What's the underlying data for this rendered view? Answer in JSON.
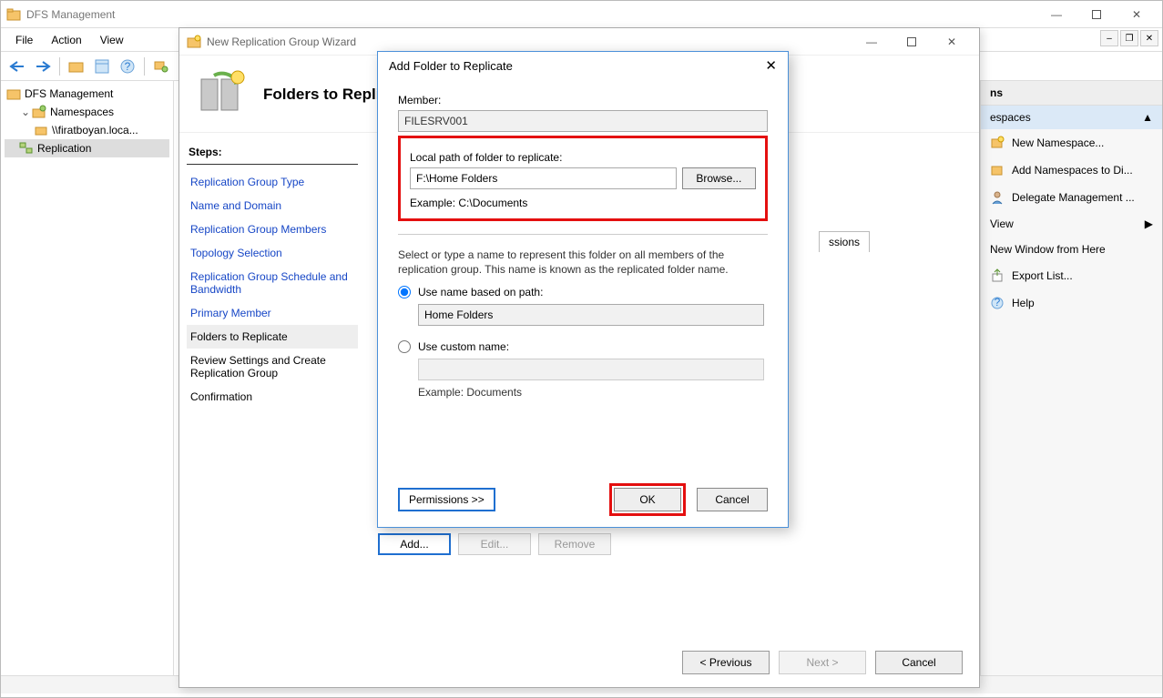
{
  "main": {
    "title": "DFS Management",
    "menubar": [
      "File",
      "Action",
      "View"
    ],
    "tree": {
      "root": "DFS Management",
      "namespaces": "Namespaces",
      "ns_item": "\\\\firatboyan.loca...",
      "replication": "Replication"
    }
  },
  "actions": {
    "header": "ns",
    "sub": "espaces",
    "items": [
      "New Namespace...",
      "Add Namespaces to Di...",
      "Delegate Management ...",
      "View",
      "New Window from Here",
      "Export List...",
      "Help"
    ]
  },
  "wizard": {
    "title": "New Replication Group Wizard",
    "header": "Folders to Repli",
    "steps_label": "Steps:",
    "steps": [
      "Replication Group Type",
      "Name and Domain",
      "Replication Group Members",
      "Topology Selection",
      "Replication Group Schedule and Bandwidth",
      "Primary Member",
      "Folders to Replicate",
      "Review Settings and Create Replication Group",
      "Confirmation"
    ],
    "table_partial_col": "ssions",
    "buttons": {
      "add": "Add...",
      "edit": "Edit...",
      "remove": "Remove"
    },
    "footer": {
      "prev": "< Previous",
      "next": "Next >",
      "cancel": "Cancel"
    }
  },
  "dialog": {
    "title": "Add Folder to Replicate",
    "member_label": "Member:",
    "member_value": "FILESRV001",
    "path_label": "Local path of folder to replicate:",
    "path_value": "F:\\Home Folders",
    "browse": "Browse...",
    "path_example": "Example: C:\\Documents",
    "desc": "Select or type a name to represent this folder on all members of the replication group. This name is known as the replicated folder name.",
    "radio_path": "Use name based on path:",
    "name_value": "Home Folders",
    "radio_custom": "Use custom name:",
    "custom_example": "Example: Documents",
    "permissions": "Permissions >>",
    "ok": "OK",
    "cancel": "Cancel"
  }
}
